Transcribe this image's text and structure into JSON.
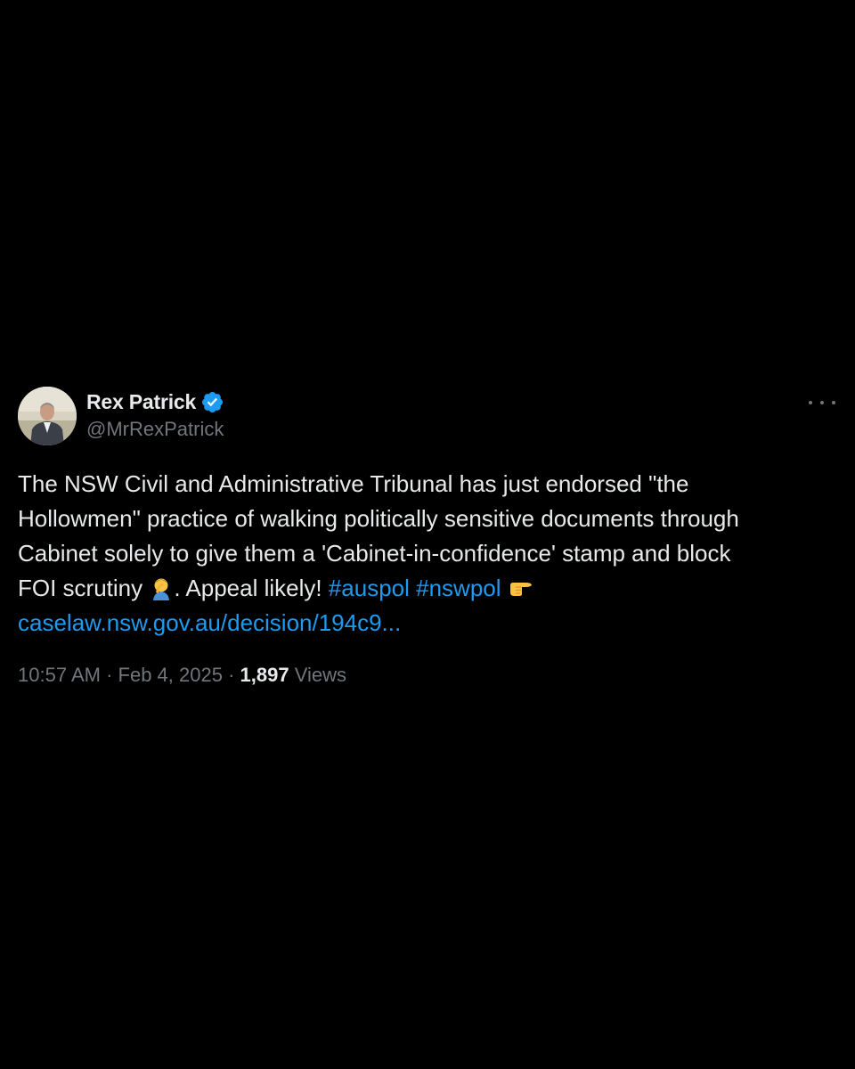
{
  "author": {
    "display_name": "Rex Patrick",
    "handle": "@MrRexPatrick",
    "verified_icon": "verified-badge-icon",
    "avatar_icon": "profile-photo"
  },
  "menu": {
    "icon": "more-options-icon"
  },
  "post": {
    "line1": "The NSW Civil and Administrative Tribunal has just endorsed \"the",
    "line2": "Hollowmen\" practice of walking politically sensitive documents through",
    "line3": "Cabinet solely to give them a 'Cabinet-in-confidence' stamp and block",
    "line4_text": "FOI scrutiny",
    "emoji_facepalm": "man-facepalming-emoji",
    "line4_text2": ". Appeal likely!",
    "hashtag1": "#auspol",
    "hashtag2": "#nswpol",
    "emoji_pointing": "pointing-right-emoji",
    "link": "caselaw.nsw.gov.au/decision/194c9..."
  },
  "meta": {
    "time": "10:57 AM",
    "sep1": " · ",
    "date": "Feb 4, 2025",
    "sep2": " · ",
    "views_count": "1,897",
    "views_label": "Views"
  },
  "colors": {
    "background": "#000000",
    "text": "#e7e9ea",
    "secondary": "#71767b",
    "accent": "#1d9bf0"
  }
}
